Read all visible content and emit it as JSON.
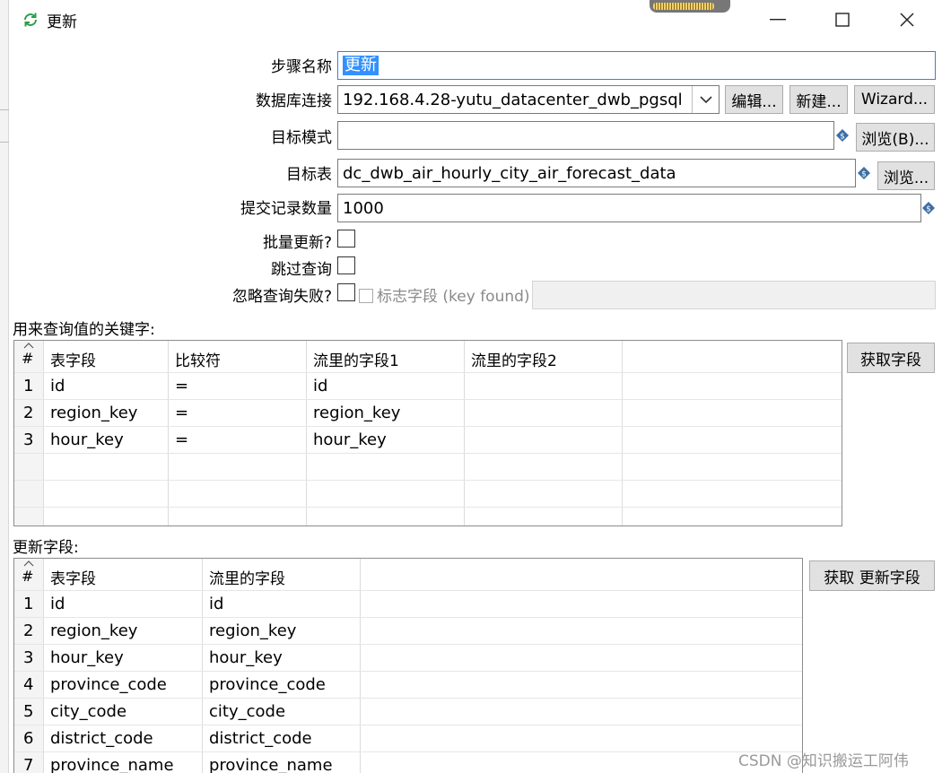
{
  "window": {
    "title": "更新"
  },
  "form": {
    "step_name": {
      "label": "步骤名称",
      "value": "更新"
    },
    "db_connection": {
      "label": "数据库连接",
      "value": "192.168.4.28-yutu_datacenter_dwb_pgsql",
      "edit_label": "编辑...",
      "new_label": "新建...",
      "wizard_label": "Wizard..."
    },
    "target_schema": {
      "label": "目标模式",
      "value": "",
      "browse_label": "浏览(B)..."
    },
    "target_table": {
      "label": "目标表",
      "value": "dc_dwb_air_hourly_city_air_forecast_data",
      "browse_label": "浏览..."
    },
    "commit_size": {
      "label": "提交记录数量",
      "value": "1000"
    },
    "batch_update": {
      "label": "批量更新?",
      "checked": false
    },
    "skip_lookup": {
      "label": "跳过查询",
      "checked": false
    },
    "ignore_lookup_failure": {
      "label": "忽略查询失败?",
      "checked": false
    },
    "flag_field": {
      "label": "标志字段 (key found)",
      "value": ""
    }
  },
  "key_section": {
    "title": "用来查询值的关键字:",
    "get_fields_label": "获取字段",
    "columns": [
      "#",
      "表字段",
      "比较符",
      "流里的字段1",
      "流里的字段2"
    ],
    "rows": [
      {
        "n": "1",
        "table_field": "id",
        "comparator": "=",
        "stream1": "id",
        "stream2": ""
      },
      {
        "n": "2",
        "table_field": "region_key",
        "comparator": "=",
        "stream1": "region_key",
        "stream2": ""
      },
      {
        "n": "3",
        "table_field": "hour_key",
        "comparator": "=",
        "stream1": "hour_key",
        "stream2": ""
      }
    ]
  },
  "update_section": {
    "title": "更新字段:",
    "get_update_fields_label": "获取 更新字段",
    "columns": [
      "#",
      "表字段",
      "流里的字段"
    ],
    "rows": [
      {
        "n": "1",
        "table_field": "id",
        "stream_field": "id"
      },
      {
        "n": "2",
        "table_field": "region_key",
        "stream_field": "region_key"
      },
      {
        "n": "3",
        "table_field": "hour_key",
        "stream_field": "hour_key"
      },
      {
        "n": "4",
        "table_field": "province_code",
        "stream_field": "province_code"
      },
      {
        "n": "5",
        "table_field": "city_code",
        "stream_field": "city_code"
      },
      {
        "n": "6",
        "table_field": "district_code",
        "stream_field": "district_code"
      },
      {
        "n": "7",
        "table_field": "province_name",
        "stream_field": "province_name"
      }
    ]
  },
  "watermark": "CSDN @知识搬运工阿伟",
  "colors": {
    "accent": "#3390ff",
    "refresh_icon": "#2aa148",
    "variable_icon": "#3a6ea5"
  }
}
